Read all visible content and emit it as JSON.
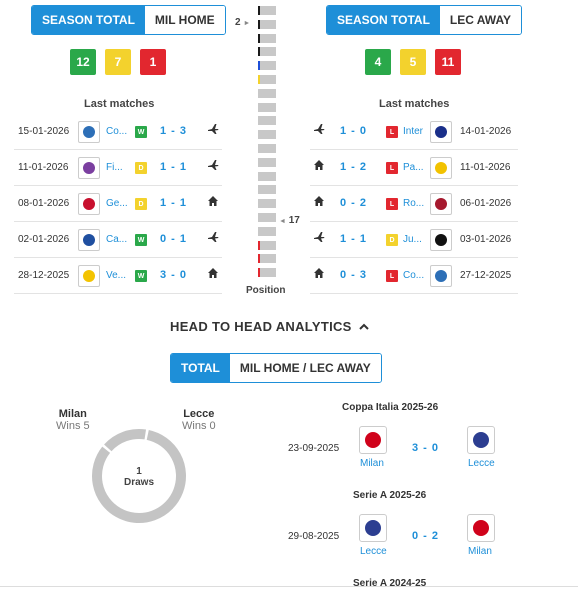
{
  "home": {
    "tab_active": "SEASON TOTAL",
    "tab_inactive": "MIL HOME",
    "wins": "12",
    "draws": "7",
    "losses": "1",
    "last_matches_title": "Last matches",
    "matches": [
      {
        "date": "15-01-2026",
        "team": "Co...",
        "result": "W",
        "score": "1 - 3",
        "venue": "away",
        "crest": "#2d6fb7"
      },
      {
        "date": "11-01-2026",
        "team": "Fi...",
        "result": "D",
        "score": "1 - 1",
        "venue": "away",
        "crest": "#7b3fa0"
      },
      {
        "date": "08-01-2026",
        "team": "Ge...",
        "result": "D",
        "score": "1 - 1",
        "venue": "home",
        "crest": "#c8102e"
      },
      {
        "date": "02-01-2026",
        "team": "Ca...",
        "result": "W",
        "score": "0 - 1",
        "venue": "away",
        "crest": "#1f4fa0"
      },
      {
        "date": "28-12-2025",
        "team": "Ve...",
        "result": "W",
        "score": "3 - 0",
        "venue": "home",
        "crest": "#f3c300"
      }
    ]
  },
  "away": {
    "tab_active": "SEASON TOTAL",
    "tab_inactive": "LEC AWAY",
    "wins": "4",
    "draws": "5",
    "losses": "11",
    "last_matches_title": "Last matches",
    "matches": [
      {
        "venue": "away",
        "score": "1 - 0",
        "result": "L",
        "team": "Inter",
        "date": "14-01-2026",
        "crest": "#1a2f8a"
      },
      {
        "venue": "home",
        "score": "1 - 2",
        "result": "L",
        "team": "Pa...",
        "date": "11-01-2026",
        "crest": "#f2c200"
      },
      {
        "venue": "home",
        "score": "0 - 2",
        "result": "L",
        "team": "Ro...",
        "date": "06-01-2026",
        "crest": "#a6192e"
      },
      {
        "venue": "away",
        "score": "1 - 1",
        "result": "D",
        "team": "Ju...",
        "date": "03-01-2026",
        "crest": "#111111"
      },
      {
        "venue": "home",
        "score": "0 - 3",
        "result": "L",
        "team": "Co...",
        "date": "27-12-2025",
        "crest": "#2d6fb7"
      }
    ]
  },
  "position": {
    "label": "Position",
    "milan_position": "2",
    "lecce_position": "17",
    "milan_arrow": "►",
    "lecce_arrow": "◄"
  },
  "h2h": {
    "title": "HEAD TO HEAD ANALYTICS",
    "collapse_icon": "chevron-up-icon",
    "tab_active": "TOTAL",
    "tab_inactive": "MIL HOME / LEC AWAY",
    "home_name": "Milan",
    "home_wins": "Wins 5",
    "away_name": "Lecce",
    "away_wins": "Wins 0",
    "draws_count": "1",
    "draws_label": "Draws",
    "chart_data": {
      "type": "pie",
      "categories": [
        "Milan wins",
        "Draws",
        "Lecce wins"
      ],
      "values": [
        5,
        1,
        0
      ]
    },
    "matches": [
      {
        "competition": "Coppa Italia 2025-26",
        "date": "23-09-2025",
        "home": "Milan",
        "score": "3 - 0",
        "away": "Lecce",
        "home_crest": "#d0021b",
        "away_crest": "#2c3e91"
      },
      {
        "competition": "Serie A 2025-26",
        "date": "29-08-2025",
        "home": "Lecce",
        "score": "0 - 2",
        "away": "Milan",
        "home_crest": "#2c3e91",
        "away_crest": "#d0021b"
      },
      {
        "competition": "Serie A 2024-25"
      }
    ]
  },
  "colors": {
    "accent": "#1e8fd8",
    "win": "#2aa84a",
    "draw": "#f3d22d",
    "loss": "#e2272f"
  }
}
